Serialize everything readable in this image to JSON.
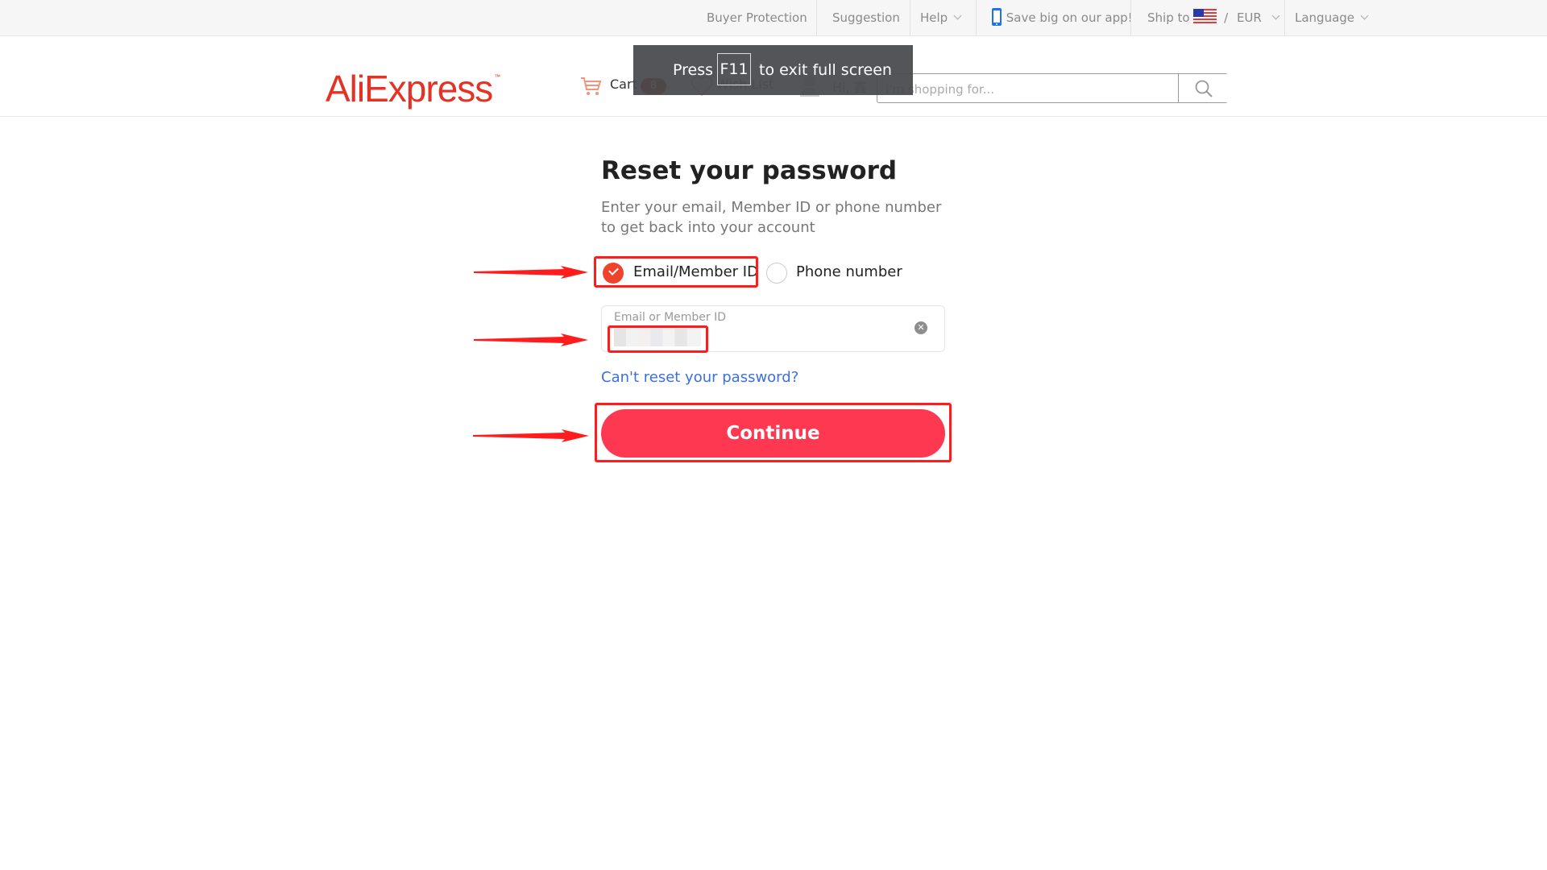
{
  "topbar": {
    "buyer_protection": "Buyer Protection",
    "suggestion": "Suggestion",
    "help": "Help",
    "app_promo": "Save big on our app!",
    "ship_to": "Ship to",
    "currency_sep": "/",
    "currency": "EUR",
    "language": "Language",
    "icons": {
      "app": "phone-icon",
      "flag": "us-flag-icon",
      "chevron": "chevron-down-icon"
    }
  },
  "header": {
    "logo": "AliExpress",
    "logo_tm": "™",
    "cart_label": "Cart",
    "cart_count": "8",
    "wishlist_label": "Wish List",
    "greeting": "Hi, 鑫",
    "search_placeholder": "I'm shopping for...",
    "brand_color": "#e43225"
  },
  "fullscreen_toast": {
    "press": "Press",
    "key": "F11",
    "message": "to exit full screen"
  },
  "form": {
    "title": "Reset your password",
    "subtitle": "Enter your email, Member ID or phone number to get back into your account",
    "radio_options": [
      {
        "label": "Email/Member ID",
        "selected": true
      },
      {
        "label": "Phone number",
        "selected": false
      }
    ],
    "field_label": "Email or Member ID",
    "field_value_note": "blurred",
    "cant_reset_link": "Can't reset your password?",
    "continue_label": "Continue",
    "accent_color": "#fe3850",
    "link_color": "#3b6fe0"
  },
  "annotations": {
    "highlight_color": "#ff1c1c",
    "arrow_count": 3
  }
}
